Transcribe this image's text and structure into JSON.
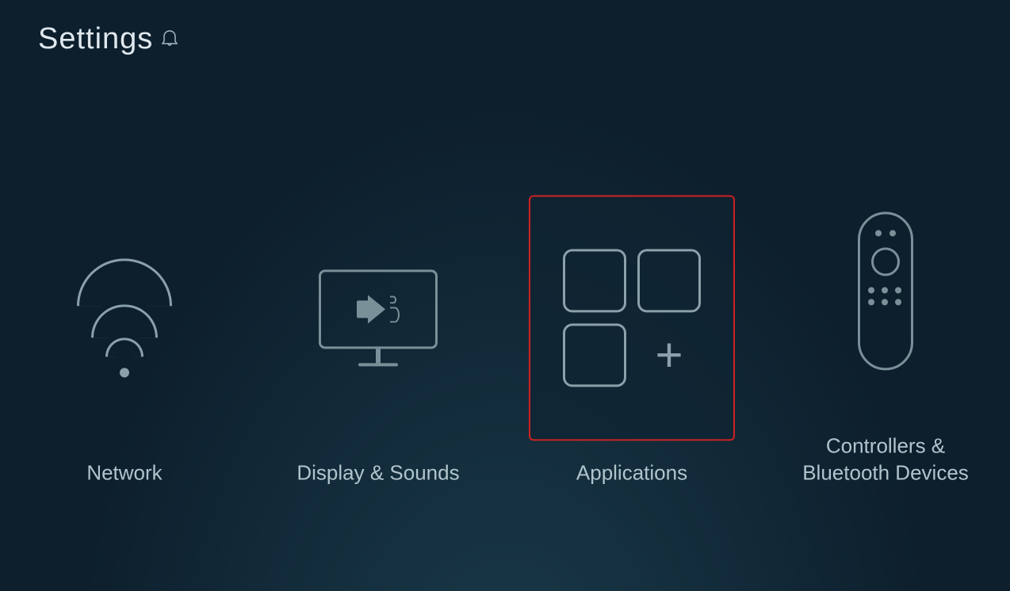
{
  "page": {
    "title": "Settings",
    "notification_icon": "bell-icon"
  },
  "settings_items": [
    {
      "id": "network",
      "label": "Network",
      "icon": "wifi-icon",
      "selected": false
    },
    {
      "id": "display-sounds",
      "label": "Display & Sounds",
      "icon": "display-icon",
      "selected": false
    },
    {
      "id": "applications",
      "label": "Applications",
      "icon": "apps-icon",
      "selected": true
    },
    {
      "id": "controllers",
      "label": "Controllers & Bluetooth Devices",
      "icon": "remote-icon",
      "selected": false
    }
  ]
}
